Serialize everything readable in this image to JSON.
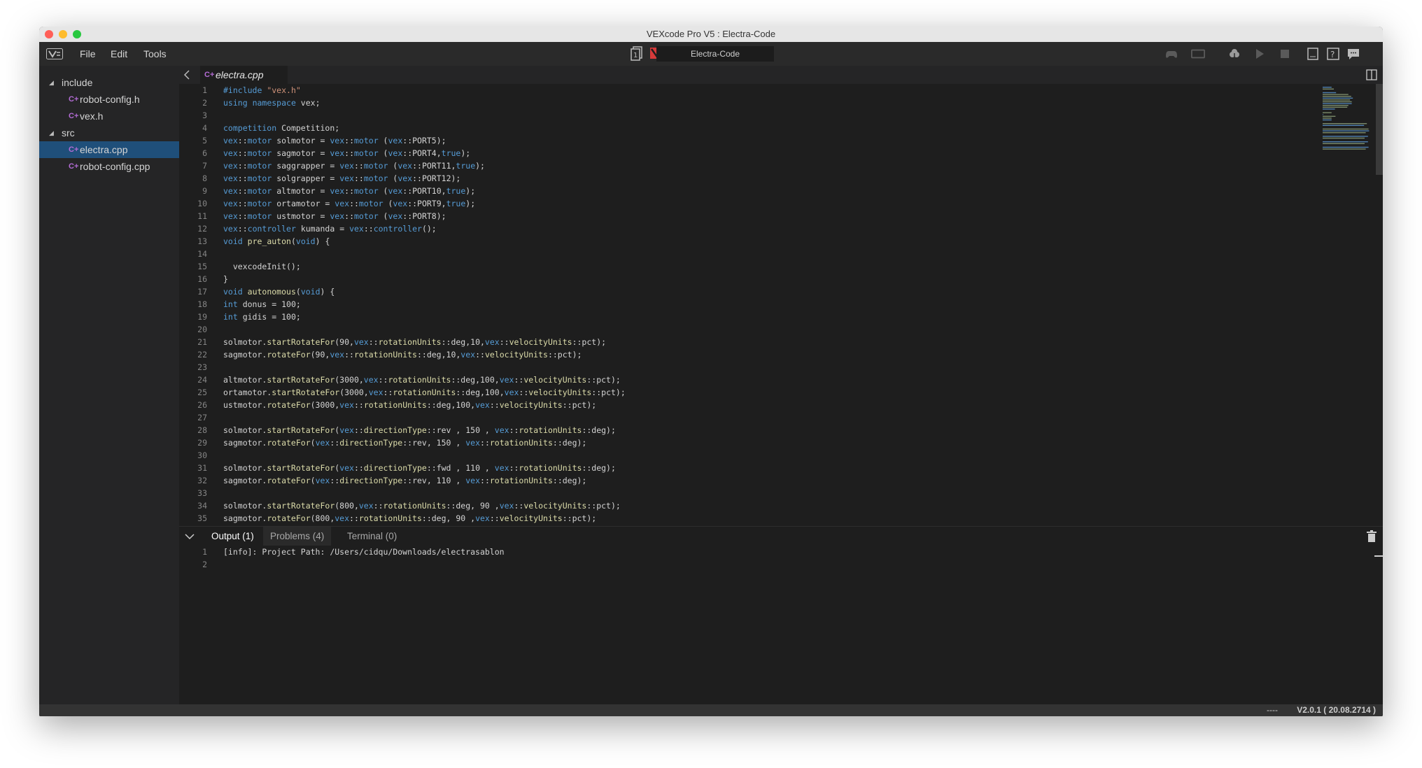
{
  "window": {
    "title": "VEXcode Pro V5 : Electra-Code"
  },
  "menu": {
    "items": [
      "File",
      "Edit",
      "Tools"
    ]
  },
  "project": {
    "name": "Electra-Code",
    "slot": "1"
  },
  "sidebar": {
    "items": [
      {
        "label": "include",
        "type": "folder"
      },
      {
        "label": "robot-config.h",
        "type": "file"
      },
      {
        "label": "vex.h",
        "type": "file"
      },
      {
        "label": "src",
        "type": "folder"
      },
      {
        "label": "electra.cpp",
        "type": "file",
        "selected": true
      },
      {
        "label": "robot-config.cpp",
        "type": "file"
      }
    ]
  },
  "editor": {
    "tab": "electra.cpp",
    "lines": [
      "#include \"vex.h\"",
      "using namespace vex;",
      "",
      "competition Competition;",
      "vex::motor solmotor = vex::motor (vex::PORT5);",
      "vex::motor sagmotor = vex::motor (vex::PORT4,true);",
      "vex::motor saggrapper = vex::motor (vex::PORT11,true);",
      "vex::motor solgrapper = vex::motor (vex::PORT12);",
      "vex::motor altmotor = vex::motor (vex::PORT10,true);",
      "vex::motor ortamotor = vex::motor (vex::PORT9,true);",
      "vex::motor ustmotor = vex::motor (vex::PORT8);",
      "vex::controller kumanda = vex::controller();",
      "void pre_auton(void) {",
      "",
      "  vexcodeInit();",
      "}",
      "void autonomous(void) {",
      "int donus = 100;",
      "int gidis = 100;",
      "",
      "solmotor.startRotateFor(90,vex::rotationUnits::deg,10,vex::velocityUnits::pct);",
      "sagmotor.rotateFor(90,vex::rotationUnits::deg,10,vex::velocityUnits::pct);",
      "",
      "altmotor.startRotateFor(3000,vex::rotationUnits::deg,100,vex::velocityUnits::pct);",
      "ortamotor.startRotateFor(3000,vex::rotationUnits::deg,100,vex::velocityUnits::pct);",
      "ustmotor.rotateFor(3000,vex::rotationUnits::deg,100,vex::velocityUnits::pct);",
      "",
      "solmotor.startRotateFor(vex::directionType::rev , 150 , vex::rotationUnits::deg);",
      "sagmotor.rotateFor(vex::directionType::rev, 150 , vex::rotationUnits::deg);",
      "",
      "solmotor.startRotateFor(vex::directionType::fwd , 110 , vex::rotationUnits::deg);",
      "sagmotor.rotateFor(vex::directionType::rev, 110 , vex::rotationUnits::deg);",
      "",
      "solmotor.startRotateFor(800,vex::rotationUnits::deg, 90 ,vex::velocityUnits::pct);",
      "sagmotor.rotateFor(800,vex::rotationUnits::deg, 90 ,vex::velocityUnits::pct);"
    ]
  },
  "panel": {
    "tabs": [
      "Output (1)",
      "Problems (4)",
      "Terminal (0)"
    ],
    "output_lines": [
      "[info]: Project Path: /Users/cidqu/Downloads/electrasablon",
      ""
    ]
  },
  "status": {
    "left": "----",
    "version": "V2.0.1 ( 20.08.2714 )"
  },
  "colors": {
    "keyword": "#569cd6",
    "function": "#dcdcaa",
    "namespace": "#4ec9b0",
    "number": "#b5cea8",
    "string": "#ce9178",
    "selection": "#1f4f7a"
  }
}
